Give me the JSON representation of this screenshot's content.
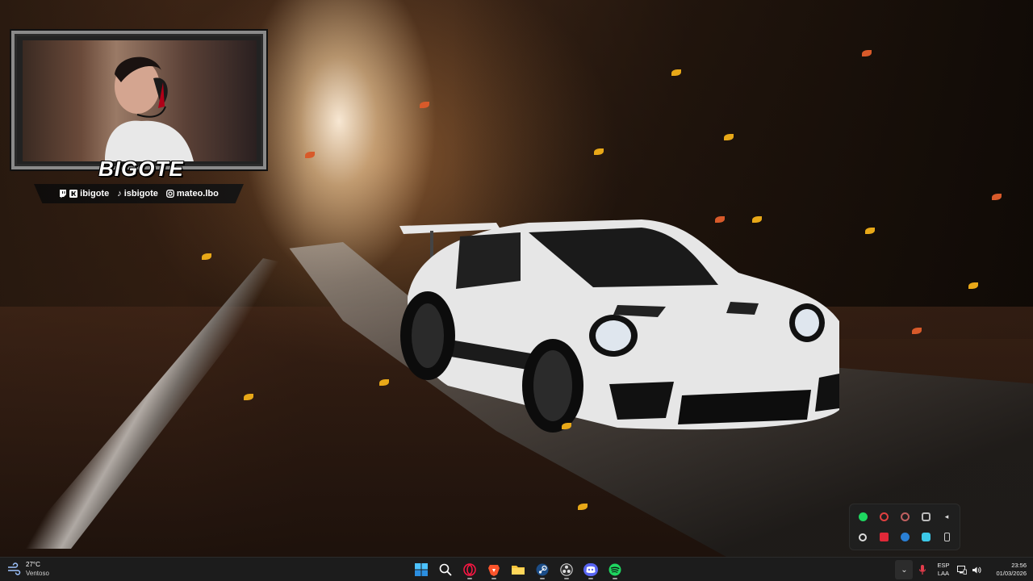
{
  "overlay": {
    "name": "BIGOTE",
    "socials": [
      {
        "icon": "twitch-icon",
        "handle": "ibigote"
      },
      {
        "icon": "kick-icon",
        "handle": "ibigote"
      },
      {
        "icon": "tiktok-icon",
        "handle": "isbigote"
      },
      {
        "icon": "instagram-icon",
        "handle": "mateo.lbo"
      }
    ]
  },
  "taskbar": {
    "weather": {
      "temp": "27°C",
      "desc": "Ventoso"
    },
    "apps": [
      {
        "name": "start",
        "icon": "windows-icon"
      },
      {
        "name": "search",
        "icon": "search-icon"
      },
      {
        "name": "opera-gx",
        "icon": "opera-icon"
      },
      {
        "name": "brave",
        "icon": "brave-icon"
      },
      {
        "name": "file-explorer",
        "icon": "folder-icon"
      },
      {
        "name": "steam",
        "icon": "steam-icon"
      },
      {
        "name": "obs",
        "icon": "obs-icon"
      },
      {
        "name": "discord",
        "icon": "discord-icon"
      },
      {
        "name": "spotify",
        "icon": "spotify-icon"
      }
    ],
    "language": {
      "line1": "ESP",
      "line2": "LAA"
    },
    "clock": {
      "time": "23:56",
      "date": "01/03/2026"
    }
  },
  "tray_popup": {
    "icons": [
      "spotify-icon",
      "record-icon",
      "app-icon",
      "overlay-icon",
      "arrow-icon",
      "settings-icon",
      "red-app-icon",
      "steam-icon",
      "cyan-app-icon",
      "usb-icon"
    ]
  },
  "colors": {
    "taskbar_bg": "#1c1c1c",
    "leaf_yellow": "#e8a818",
    "leaf_red": "#d85a2a",
    "spotify": "#1ed760",
    "discord": "#5865f2"
  }
}
